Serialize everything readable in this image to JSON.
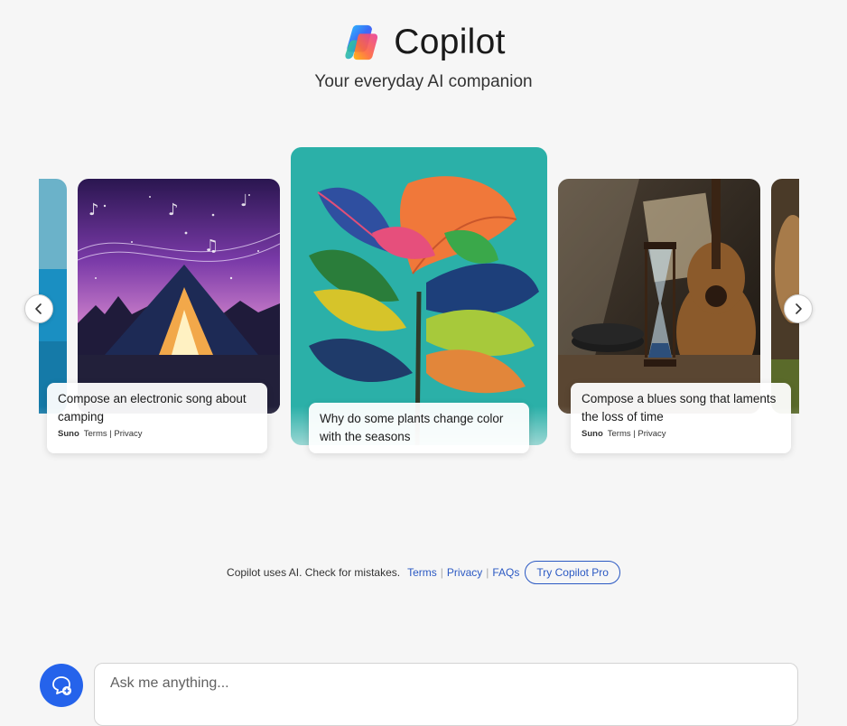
{
  "app": {
    "title": "Copilot",
    "subtitle": "Your everyday AI companion",
    "logo_icon": "copilot-logo-icon"
  },
  "carousel": {
    "cards": [
      {
        "image": "tent-under-starry-sky-with-music-notes",
        "caption": "Compose an electronic song about camping",
        "provider": "Suno",
        "terms_label": "Terms",
        "privacy_label": "Privacy"
      },
      {
        "image": "colorful-fiddle-leaf-plant-painting",
        "caption": "Why do some plants change color with the seasons"
      },
      {
        "image": "hourglass-guitar-and-records",
        "caption": "Compose a blues song that laments the loss of time",
        "provider": "Suno",
        "terms_label": "Terms",
        "privacy_label": "Privacy"
      }
    ],
    "prev_icon": "chevron-left-icon",
    "next_icon": "chevron-right-icon"
  },
  "footer": {
    "disclaimer": "Copilot uses AI. Check for mistakes.",
    "terms": "Terms",
    "privacy": "Privacy",
    "faqs": "FAQs",
    "pro_button": "Try Copilot Pro"
  },
  "composer": {
    "placeholder": "Ask me anything...",
    "new_topic_icon": "new-topic-chat-icon"
  },
  "colors": {
    "accent": "#2563eb",
    "link": "#2b59c3",
    "background": "#f6f6f6"
  }
}
